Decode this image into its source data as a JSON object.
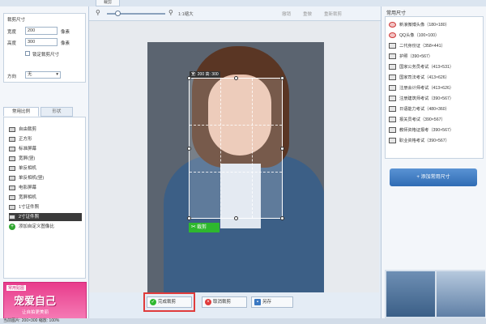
{
  "toolbar": {
    "zoom_label": "1:1缩大",
    "tab_label": "裁剪",
    "undo": "撤销",
    "redo": "重做",
    "reset": "重新裁剪"
  },
  "left": {
    "section_title": "裁剪尺寸",
    "width_label": "宽度",
    "width_value": "200",
    "height_label": "高度",
    "height_value": "300",
    "unit": "像素",
    "lock_label": "锁定裁剪尺寸",
    "direction_label": "方向",
    "direction_value": "无",
    "tabs": [
      "常用比例",
      "形状"
    ],
    "list": [
      "自由裁剪",
      "正方形",
      "标准屏幕",
      "宽屏(竖)",
      "单反相机",
      "单反相机(竖)",
      "电影屏幕",
      "宽屏相机",
      "1寸证件照",
      "2寸证件照",
      "添加自定义图像比"
    ],
    "promo_text": "宠爱自己",
    "promo_sub": "让自拍更美丽",
    "promo_tag": "常用贴图"
  },
  "canvas": {
    "dimension_text": "宽: 200  高: 300",
    "crop_button": "裁剪",
    "watermark": "经验"
  },
  "bottom": {
    "finish": "完成裁剪",
    "cancel": "取消裁剪",
    "save": "另存"
  },
  "right": {
    "title": "常用尺寸",
    "items": [
      "新浪微博头像（180×180）",
      "QQ头像（100×100）",
      "二代身份证（358×441）",
      "护照（390×567）",
      "国家公务员考试（413×531）",
      "国家司法考试（413×626）",
      "注册会计师考试（413×626）",
      "注册建筑师考试（390×567）",
      "日语能力考试（480×360）",
      "报关员考试（390×567）",
      "教师资格证报考（390×567）",
      "职业资格考试（390×567）"
    ],
    "add_button": "+ 添加常用尺寸"
  },
  "status": {
    "text": "当前图片: 200×300  缩放: 100%"
  }
}
